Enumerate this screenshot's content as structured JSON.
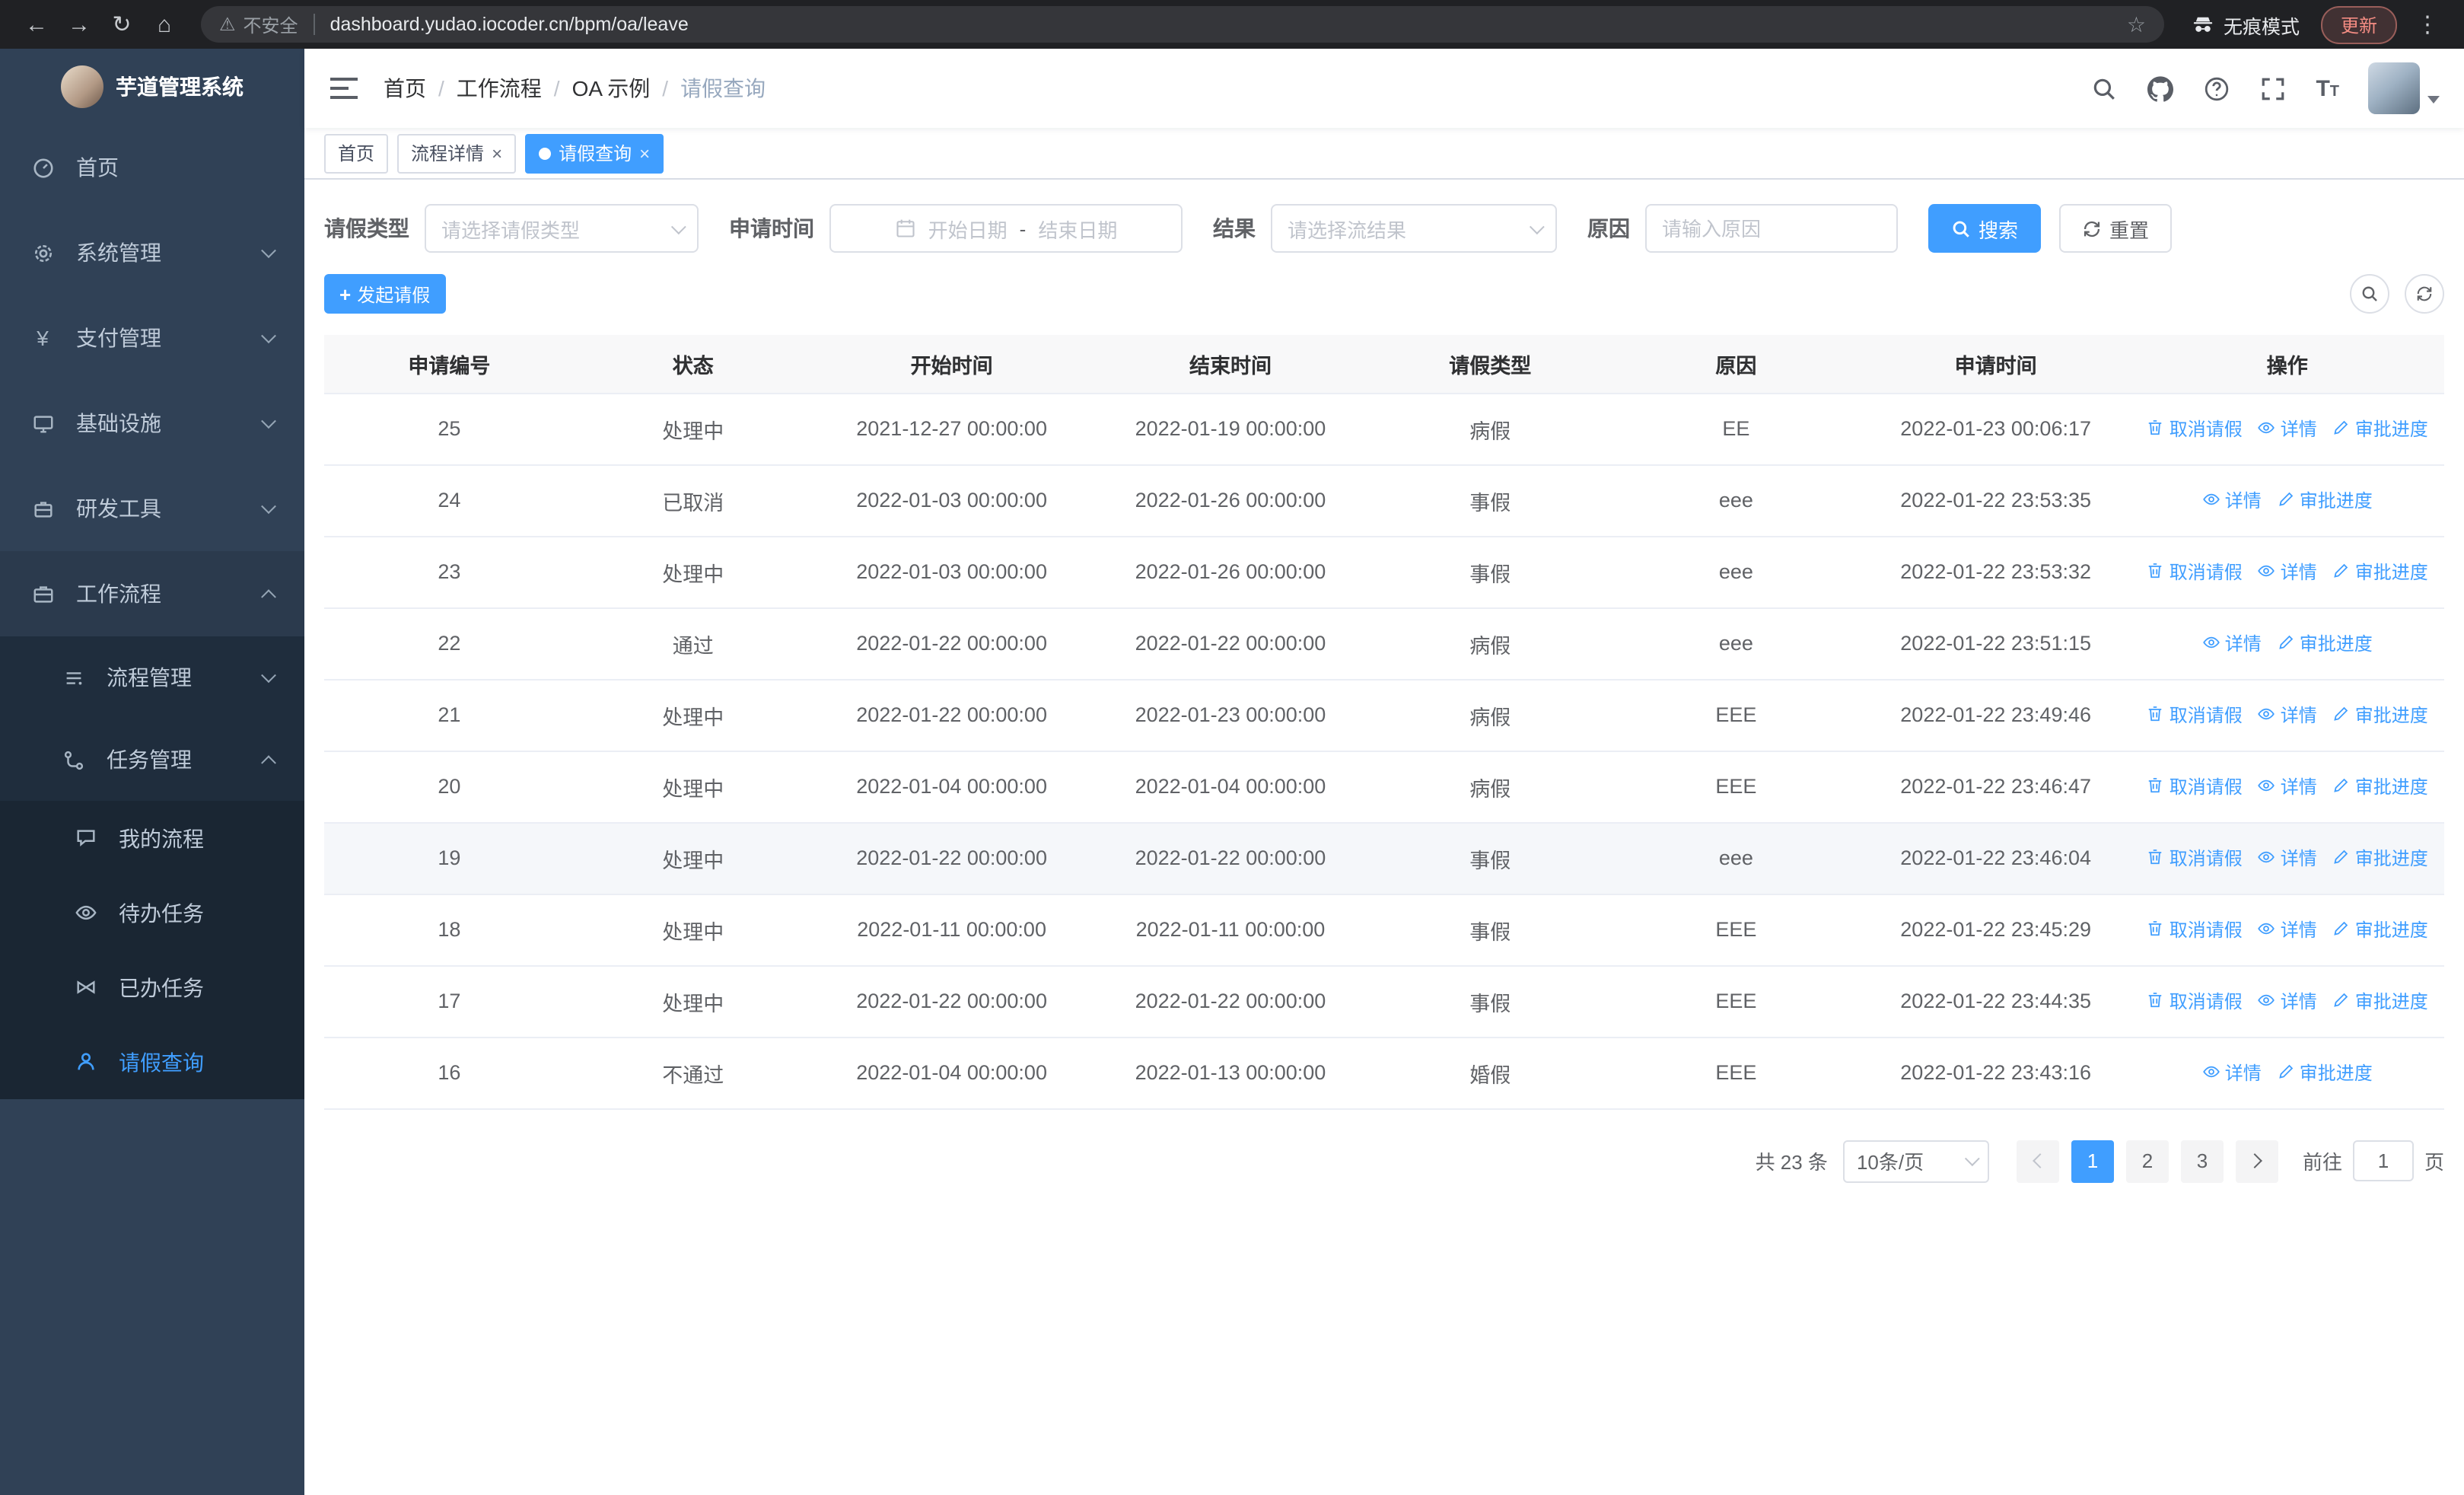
{
  "browser": {
    "security_label": "不安全",
    "url": "dashboard.yudao.iocoder.cn/bpm/oa/leave",
    "incognito_label": "无痕模式",
    "update_label": "更新"
  },
  "sidebar": {
    "app_title": "芋道管理系统",
    "menu": [
      {
        "label": "首页"
      },
      {
        "label": "系统管理"
      },
      {
        "label": "支付管理"
      },
      {
        "label": "基础设施"
      },
      {
        "label": "研发工具"
      },
      {
        "label": "工作流程"
      }
    ],
    "workflow_children": [
      {
        "label": "流程管理"
      },
      {
        "label": "任务管理"
      }
    ],
    "task_children": [
      {
        "label": "我的流程"
      },
      {
        "label": "待办任务"
      },
      {
        "label": "已办任务"
      },
      {
        "label": "请假查询"
      }
    ]
  },
  "header": {
    "breadcrumb": [
      "首页",
      "工作流程",
      "OA 示例",
      "请假查询"
    ]
  },
  "tabs": [
    {
      "label": "首页",
      "closable": false,
      "active": false
    },
    {
      "label": "流程详情",
      "closable": true,
      "active": false
    },
    {
      "label": "请假查询",
      "closable": true,
      "active": true
    }
  ],
  "filters": {
    "leave_type_label": "请假类型",
    "leave_type_placeholder": "请选择请假类型",
    "apply_time_label": "申请时间",
    "start_date_placeholder": "开始日期",
    "range_separator": "-",
    "end_date_placeholder": "结束日期",
    "result_label": "结果",
    "result_placeholder": "请选择流结果",
    "reason_label": "原因",
    "reason_placeholder": "请输入原因",
    "search_label": "搜索",
    "reset_label": "重置"
  },
  "toolbar": {
    "create_label": "发起请假"
  },
  "table": {
    "columns": [
      "申请编号",
      "状态",
      "开始时间",
      "结束时间",
      "请假类型",
      "原因",
      "申请时间",
      "操作"
    ],
    "action_labels": {
      "cancel": "取消请假",
      "detail": "详情",
      "progress": "审批进度"
    },
    "rows": [
      {
        "id": "25",
        "status": "处理中",
        "start": "2021-12-27 00:00:00",
        "end": "2022-01-19 00:00:00",
        "type": "病假",
        "reason": "EE",
        "applied": "2022-01-23 00:06:17",
        "actions": [
          "cancel",
          "detail",
          "progress"
        ]
      },
      {
        "id": "24",
        "status": "已取消",
        "start": "2022-01-03 00:00:00",
        "end": "2022-01-26 00:00:00",
        "type": "事假",
        "reason": "eee",
        "applied": "2022-01-22 23:53:35",
        "actions": [
          "detail",
          "progress"
        ]
      },
      {
        "id": "23",
        "status": "处理中",
        "start": "2022-01-03 00:00:00",
        "end": "2022-01-26 00:00:00",
        "type": "事假",
        "reason": "eee",
        "applied": "2022-01-22 23:53:32",
        "actions": [
          "cancel",
          "detail",
          "progress"
        ]
      },
      {
        "id": "22",
        "status": "通过",
        "start": "2022-01-22 00:00:00",
        "end": "2022-01-22 00:00:00",
        "type": "病假",
        "reason": "eee",
        "applied": "2022-01-22 23:51:15",
        "actions": [
          "detail",
          "progress"
        ]
      },
      {
        "id": "21",
        "status": "处理中",
        "start": "2022-01-22 00:00:00",
        "end": "2022-01-23 00:00:00",
        "type": "病假",
        "reason": "EEE",
        "applied": "2022-01-22 23:49:46",
        "actions": [
          "cancel",
          "detail",
          "progress"
        ]
      },
      {
        "id": "20",
        "status": "处理中",
        "start": "2022-01-04 00:00:00",
        "end": "2022-01-04 00:00:00",
        "type": "病假",
        "reason": "EEE",
        "applied": "2022-01-22 23:46:47",
        "actions": [
          "cancel",
          "detail",
          "progress"
        ]
      },
      {
        "id": "19",
        "status": "处理中",
        "start": "2022-01-22 00:00:00",
        "end": "2022-01-22 00:00:00",
        "type": "事假",
        "reason": "eee",
        "applied": "2022-01-22 23:46:04",
        "actions": [
          "cancel",
          "detail",
          "progress"
        ],
        "highlighted": true
      },
      {
        "id": "18",
        "status": "处理中",
        "start": "2022-01-11 00:00:00",
        "end": "2022-01-11 00:00:00",
        "type": "事假",
        "reason": "EEE",
        "applied": "2022-01-22 23:45:29",
        "actions": [
          "cancel",
          "detail",
          "progress"
        ]
      },
      {
        "id": "17",
        "status": "处理中",
        "start": "2022-01-22 00:00:00",
        "end": "2022-01-22 00:00:00",
        "type": "事假",
        "reason": "EEE",
        "applied": "2022-01-22 23:44:35",
        "actions": [
          "cancel",
          "detail",
          "progress"
        ]
      },
      {
        "id": "16",
        "status": "不通过",
        "start": "2022-01-04 00:00:00",
        "end": "2022-01-13 00:00:00",
        "type": "婚假",
        "reason": "EEE",
        "applied": "2022-01-22 23:43:16",
        "actions": [
          "detail",
          "progress"
        ]
      }
    ]
  },
  "pagination": {
    "total_text": "共 23 条",
    "page_size": "10条/页",
    "pages": [
      "1",
      "2",
      "3"
    ],
    "active_page": "1",
    "goto_label": "前往",
    "goto_value": "1",
    "goto_suffix": "页"
  },
  "colors": {
    "primary": "#409EFF",
    "sidebar_bg": "#304156",
    "sidebar_submenu_bg": "#1f2d3d",
    "active_text": "#409EFF",
    "chrome_bg": "#202124",
    "update_chip_text": "#f28b82"
  }
}
